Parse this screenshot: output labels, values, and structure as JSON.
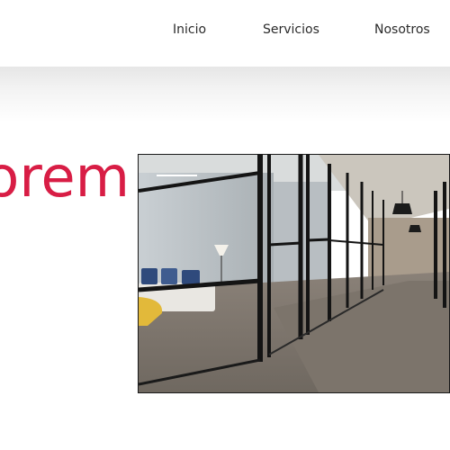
{
  "nav": {
    "items": [
      {
        "label": "Inicio"
      },
      {
        "label": "Servicios"
      },
      {
        "label": "Nosotros"
      }
    ]
  },
  "hero": {
    "title_fragment": "orem",
    "image": {
      "icon": "office-corridor-photo"
    }
  },
  "colors": {
    "accent": "#d81d45",
    "nav_text": "#2b2b2b",
    "band": "#ececec"
  }
}
